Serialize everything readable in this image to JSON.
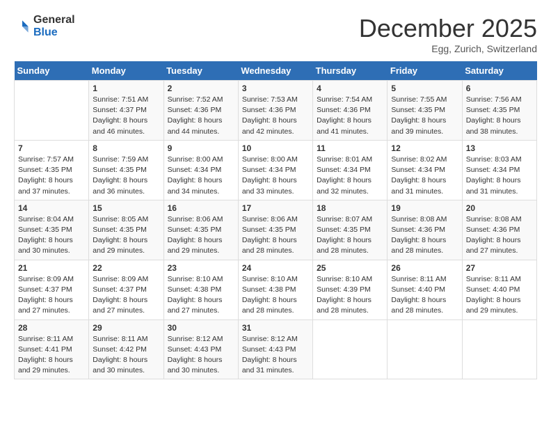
{
  "logo": {
    "general": "General",
    "blue": "Blue"
  },
  "title": "December 2025",
  "subtitle": "Egg, Zurich, Switzerland",
  "days_of_week": [
    "Sunday",
    "Monday",
    "Tuesday",
    "Wednesday",
    "Thursday",
    "Friday",
    "Saturday"
  ],
  "weeks": [
    [
      {
        "day": "",
        "sunrise": "",
        "sunset": "",
        "daylight": ""
      },
      {
        "day": "1",
        "sunrise": "Sunrise: 7:51 AM",
        "sunset": "Sunset: 4:37 PM",
        "daylight": "Daylight: 8 hours and 46 minutes."
      },
      {
        "day": "2",
        "sunrise": "Sunrise: 7:52 AM",
        "sunset": "Sunset: 4:36 PM",
        "daylight": "Daylight: 8 hours and 44 minutes."
      },
      {
        "day": "3",
        "sunrise": "Sunrise: 7:53 AM",
        "sunset": "Sunset: 4:36 PM",
        "daylight": "Daylight: 8 hours and 42 minutes."
      },
      {
        "day": "4",
        "sunrise": "Sunrise: 7:54 AM",
        "sunset": "Sunset: 4:36 PM",
        "daylight": "Daylight: 8 hours and 41 minutes."
      },
      {
        "day": "5",
        "sunrise": "Sunrise: 7:55 AM",
        "sunset": "Sunset: 4:35 PM",
        "daylight": "Daylight: 8 hours and 39 minutes."
      },
      {
        "day": "6",
        "sunrise": "Sunrise: 7:56 AM",
        "sunset": "Sunset: 4:35 PM",
        "daylight": "Daylight: 8 hours and 38 minutes."
      }
    ],
    [
      {
        "day": "7",
        "sunrise": "Sunrise: 7:57 AM",
        "sunset": "Sunset: 4:35 PM",
        "daylight": "Daylight: 8 hours and 37 minutes."
      },
      {
        "day": "8",
        "sunrise": "Sunrise: 7:59 AM",
        "sunset": "Sunset: 4:35 PM",
        "daylight": "Daylight: 8 hours and 36 minutes."
      },
      {
        "day": "9",
        "sunrise": "Sunrise: 8:00 AM",
        "sunset": "Sunset: 4:34 PM",
        "daylight": "Daylight: 8 hours and 34 minutes."
      },
      {
        "day": "10",
        "sunrise": "Sunrise: 8:00 AM",
        "sunset": "Sunset: 4:34 PM",
        "daylight": "Daylight: 8 hours and 33 minutes."
      },
      {
        "day": "11",
        "sunrise": "Sunrise: 8:01 AM",
        "sunset": "Sunset: 4:34 PM",
        "daylight": "Daylight: 8 hours and 32 minutes."
      },
      {
        "day": "12",
        "sunrise": "Sunrise: 8:02 AM",
        "sunset": "Sunset: 4:34 PM",
        "daylight": "Daylight: 8 hours and 31 minutes."
      },
      {
        "day": "13",
        "sunrise": "Sunrise: 8:03 AM",
        "sunset": "Sunset: 4:34 PM",
        "daylight": "Daylight: 8 hours and 31 minutes."
      }
    ],
    [
      {
        "day": "14",
        "sunrise": "Sunrise: 8:04 AM",
        "sunset": "Sunset: 4:35 PM",
        "daylight": "Daylight: 8 hours and 30 minutes."
      },
      {
        "day": "15",
        "sunrise": "Sunrise: 8:05 AM",
        "sunset": "Sunset: 4:35 PM",
        "daylight": "Daylight: 8 hours and 29 minutes."
      },
      {
        "day": "16",
        "sunrise": "Sunrise: 8:06 AM",
        "sunset": "Sunset: 4:35 PM",
        "daylight": "Daylight: 8 hours and 29 minutes."
      },
      {
        "day": "17",
        "sunrise": "Sunrise: 8:06 AM",
        "sunset": "Sunset: 4:35 PM",
        "daylight": "Daylight: 8 hours and 28 minutes."
      },
      {
        "day": "18",
        "sunrise": "Sunrise: 8:07 AM",
        "sunset": "Sunset: 4:35 PM",
        "daylight": "Daylight: 8 hours and 28 minutes."
      },
      {
        "day": "19",
        "sunrise": "Sunrise: 8:08 AM",
        "sunset": "Sunset: 4:36 PM",
        "daylight": "Daylight: 8 hours and 28 minutes."
      },
      {
        "day": "20",
        "sunrise": "Sunrise: 8:08 AM",
        "sunset": "Sunset: 4:36 PM",
        "daylight": "Daylight: 8 hours and 27 minutes."
      }
    ],
    [
      {
        "day": "21",
        "sunrise": "Sunrise: 8:09 AM",
        "sunset": "Sunset: 4:37 PM",
        "daylight": "Daylight: 8 hours and 27 minutes."
      },
      {
        "day": "22",
        "sunrise": "Sunrise: 8:09 AM",
        "sunset": "Sunset: 4:37 PM",
        "daylight": "Daylight: 8 hours and 27 minutes."
      },
      {
        "day": "23",
        "sunrise": "Sunrise: 8:10 AM",
        "sunset": "Sunset: 4:38 PM",
        "daylight": "Daylight: 8 hours and 27 minutes."
      },
      {
        "day": "24",
        "sunrise": "Sunrise: 8:10 AM",
        "sunset": "Sunset: 4:38 PM",
        "daylight": "Daylight: 8 hours and 28 minutes."
      },
      {
        "day": "25",
        "sunrise": "Sunrise: 8:10 AM",
        "sunset": "Sunset: 4:39 PM",
        "daylight": "Daylight: 8 hours and 28 minutes."
      },
      {
        "day": "26",
        "sunrise": "Sunrise: 8:11 AM",
        "sunset": "Sunset: 4:40 PM",
        "daylight": "Daylight: 8 hours and 28 minutes."
      },
      {
        "day": "27",
        "sunrise": "Sunrise: 8:11 AM",
        "sunset": "Sunset: 4:40 PM",
        "daylight": "Daylight: 8 hours and 29 minutes."
      }
    ],
    [
      {
        "day": "28",
        "sunrise": "Sunrise: 8:11 AM",
        "sunset": "Sunset: 4:41 PM",
        "daylight": "Daylight: 8 hours and 29 minutes."
      },
      {
        "day": "29",
        "sunrise": "Sunrise: 8:11 AM",
        "sunset": "Sunset: 4:42 PM",
        "daylight": "Daylight: 8 hours and 30 minutes."
      },
      {
        "day": "30",
        "sunrise": "Sunrise: 8:12 AM",
        "sunset": "Sunset: 4:43 PM",
        "daylight": "Daylight: 8 hours and 30 minutes."
      },
      {
        "day": "31",
        "sunrise": "Sunrise: 8:12 AM",
        "sunset": "Sunset: 4:43 PM",
        "daylight": "Daylight: 8 hours and 31 minutes."
      },
      {
        "day": "",
        "sunrise": "",
        "sunset": "",
        "daylight": ""
      },
      {
        "day": "",
        "sunrise": "",
        "sunset": "",
        "daylight": ""
      },
      {
        "day": "",
        "sunrise": "",
        "sunset": "",
        "daylight": ""
      }
    ]
  ]
}
